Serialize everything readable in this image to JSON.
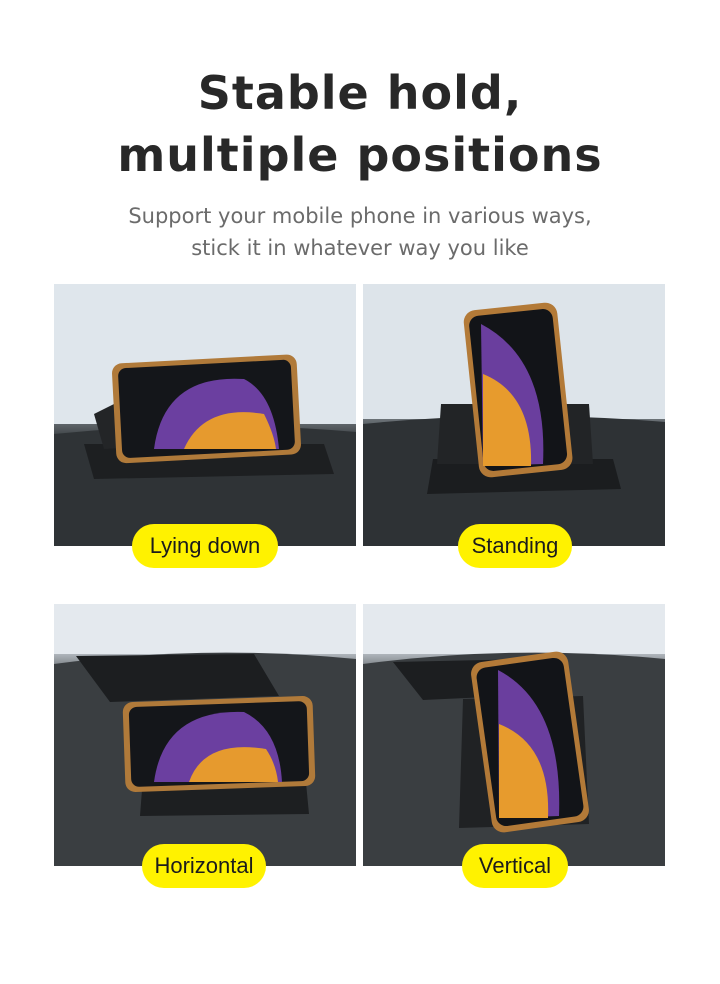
{
  "heading": {
    "line1": "Stable hold,",
    "line2": "multiple positions"
  },
  "subheading": {
    "line1": "Support your mobile phone in various ways,",
    "line2": "stick it in whatever way you like"
  },
  "positions": [
    {
      "label": "Lying down"
    },
    {
      "label": "Standing"
    },
    {
      "label": "Horizontal"
    },
    {
      "label": "Vertical"
    }
  ],
  "colors": {
    "badge": "#fff200",
    "title": "#282828",
    "subtitle": "#6b6b6b"
  }
}
